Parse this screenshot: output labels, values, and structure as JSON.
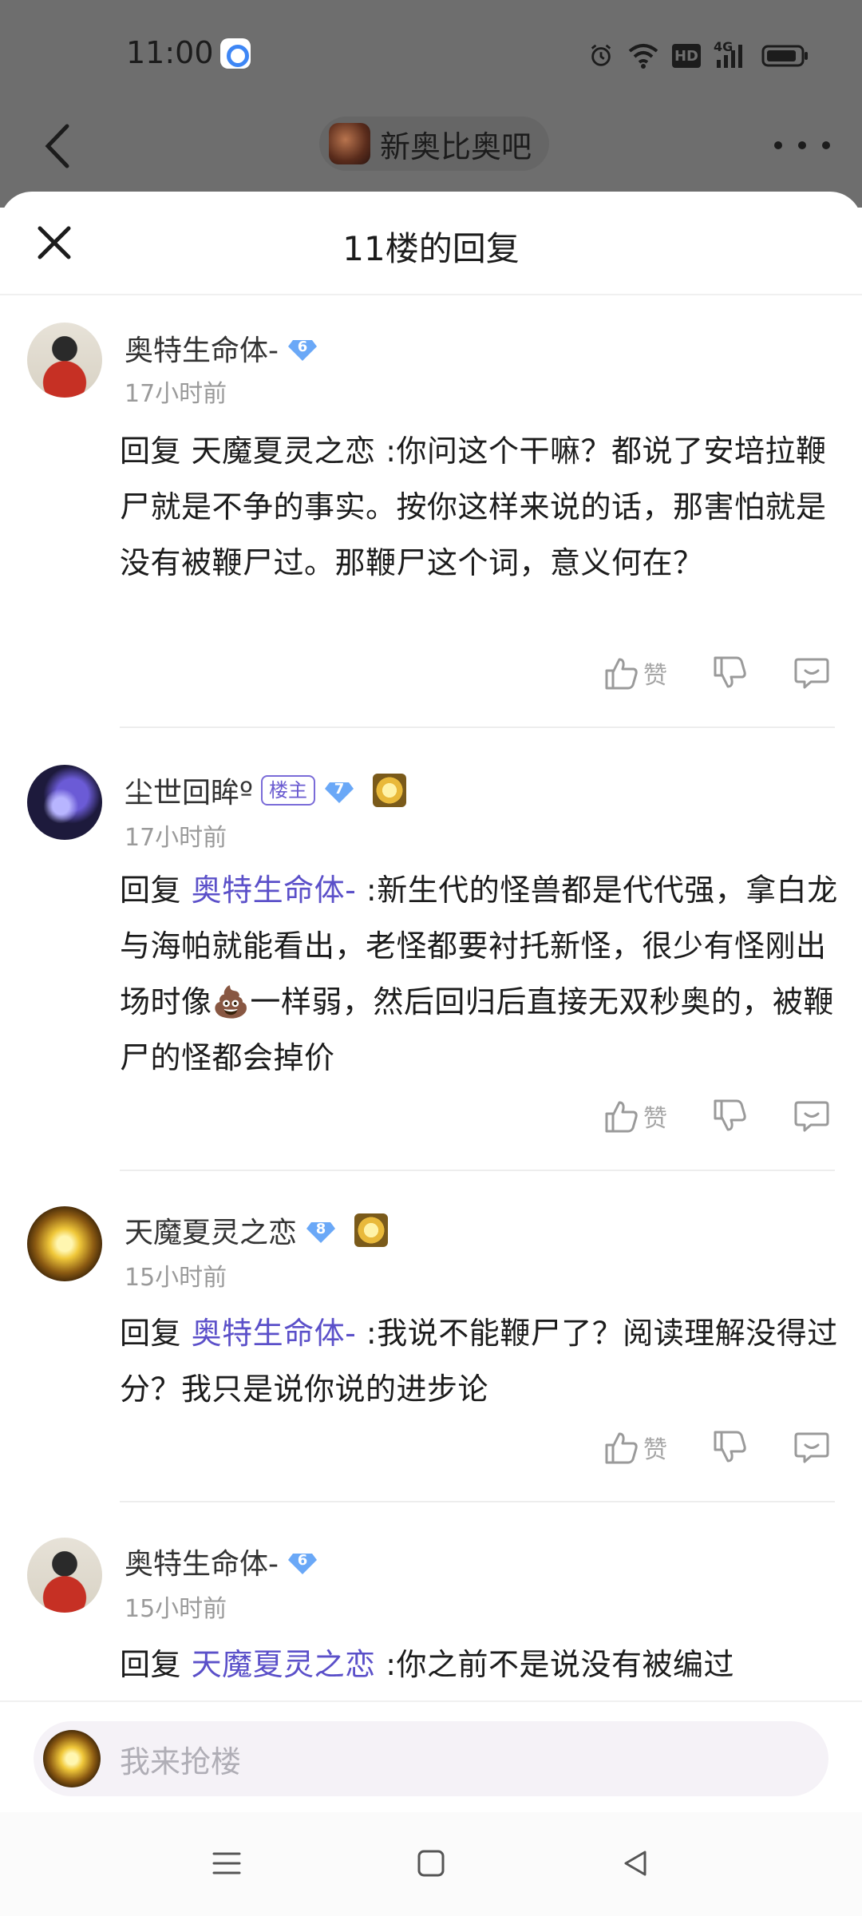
{
  "status_bar": {
    "time": "11:00",
    "network_label": "HD",
    "signal_label": "4G"
  },
  "topnav": {
    "forum_name": "新奥比奥吧"
  },
  "sheet": {
    "title": "11楼的回复"
  },
  "replies": [
    {
      "username": "奥特生命体-",
      "level": "6",
      "time": "17小时前",
      "prefix": "回复 ",
      "mention": "天魔夏灵之恋",
      "text": " :你问这个干嘛？都说了安培拉鞭尸就是不争的事实。按你这样来说的话，那害怕就是没有被鞭尸过。那鞭尸这个词，意义何在？",
      "like_label": "赞"
    },
    {
      "username": "尘世回眸º",
      "owner_badge": "楼主",
      "level": "7",
      "time": "17小时前",
      "prefix": "回复 ",
      "mention": "奥特生命体-",
      "text": " :新生代的怪兽都是代代强，拿白龙与海帕就能看出，老怪都要衬托新怪，很少有怪刚出场时像💩一样弱，然后回归后直接无双秒奥的，被鞭尸的怪都会掉价",
      "like_label": "赞"
    },
    {
      "username": "天魔夏灵之恋",
      "level": "8",
      "time": "15小时前",
      "prefix": "回复 ",
      "mention": "奥特生命体-",
      "text": " :我说不能鞭尸了？阅读理解没得过分？我只是说你说的进步论",
      "like_label": "赞"
    },
    {
      "username": "奥特生命体-",
      "level": "6",
      "time": "15小时前",
      "prefix": "回复 ",
      "mention": "天魔夏灵之恋",
      "text": " :你之前不是说没有被编过"
    }
  ],
  "input": {
    "placeholder": "我来抢楼"
  },
  "colors": {
    "mention": "#5b50c9",
    "level_badge": "#6aa8f7",
    "backdrop": "#6e6e6e"
  }
}
